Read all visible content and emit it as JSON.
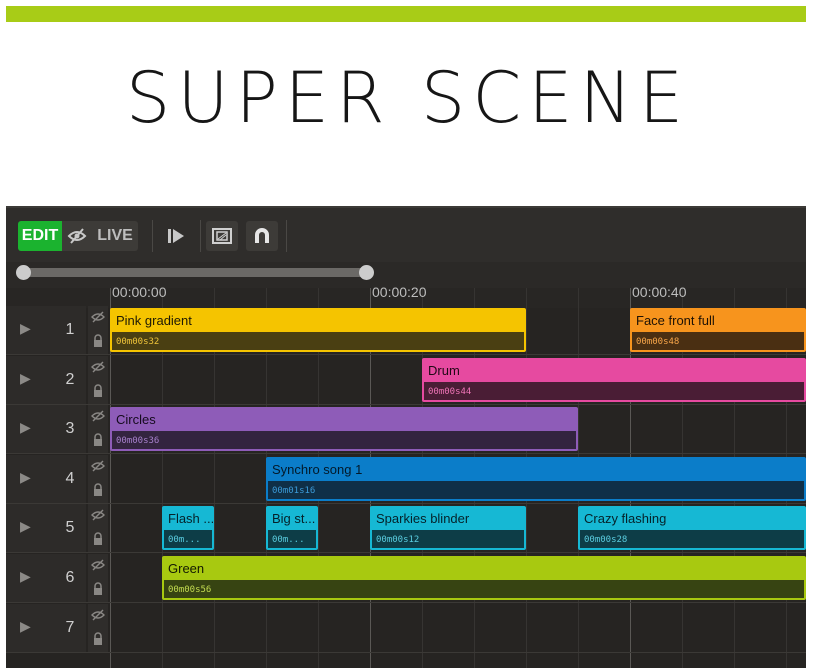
{
  "header": {
    "title": "SUPER SCENE"
  },
  "colors": {
    "accent_bar": "#a8cc17"
  },
  "toolbar": {
    "edit_label": "EDIT",
    "live_label": "LIVE",
    "icons": [
      "eye-slash-icon",
      "play-next-icon",
      "frame-icon",
      "magnet-icon"
    ]
  },
  "timeline": {
    "marks": [
      "00:00:00",
      "00:00:20",
      "00:00:40"
    ],
    "rows": [
      {
        "number": "1",
        "clips": [
          {
            "name": "Pink gradient",
            "duration": "00m00s32",
            "color": "#f5c400",
            "dark": "#4a3f12",
            "text": "#1e1a05",
            "durtext": "#f0c53a"
          },
          {
            "name": "Face front full",
            "duration": "00m00s48",
            "color": "#f7941d",
            "dark": "#4a2f12",
            "text": "#1e1205",
            "durtext": "#f8a64a"
          }
        ]
      },
      {
        "number": "2",
        "clips": [
          {
            "name": "Drum",
            "duration": "00m00s44",
            "color": "#e64aa0",
            "dark": "#4a1d35",
            "text": "#200815",
            "durtext": "#ee74b6"
          }
        ]
      },
      {
        "number": "3",
        "clips": [
          {
            "name": "Circles",
            "duration": "00m00s36",
            "color": "#8e5cb8",
            "dark": "#33243f",
            "text": "#150b1e",
            "durtext": "#a780cc"
          }
        ]
      },
      {
        "number": "4",
        "clips": [
          {
            "name": "Synchro song 1",
            "duration": "00m01s16",
            "color": "#0b7dc9",
            "dark": "#0f2f47",
            "text": "#03192a",
            "durtext": "#3b9ad8"
          }
        ]
      },
      {
        "number": "5",
        "clips": [
          {
            "name": "Flash ...",
            "duration": "00m...",
            "color": "#16b8d4",
            "dark": "#0d3d47",
            "text": "#05222a",
            "durtext": "#5acde0"
          },
          {
            "name": "Big st...",
            "duration": "00m...",
            "color": "#16b8d4",
            "dark": "#0d3d47",
            "text": "#05222a",
            "durtext": "#5acde0"
          },
          {
            "name": "Sparkies blinder",
            "duration": "00m00s12",
            "color": "#16b8d4",
            "dark": "#0d3d47",
            "text": "#05222a",
            "durtext": "#5acde0"
          },
          {
            "name": "Crazy flashing",
            "duration": "00m00s28",
            "color": "#16b8d4",
            "dark": "#0d3d47",
            "text": "#05222a",
            "durtext": "#5acde0"
          }
        ]
      },
      {
        "number": "6",
        "clips": [
          {
            "name": "Green",
            "duration": "00m00s56",
            "color": "#a8c910",
            "dark": "#374412",
            "text": "#141a03",
            "durtext": "#c3dc50"
          }
        ]
      },
      {
        "number": "7",
        "clips": []
      }
    ]
  }
}
